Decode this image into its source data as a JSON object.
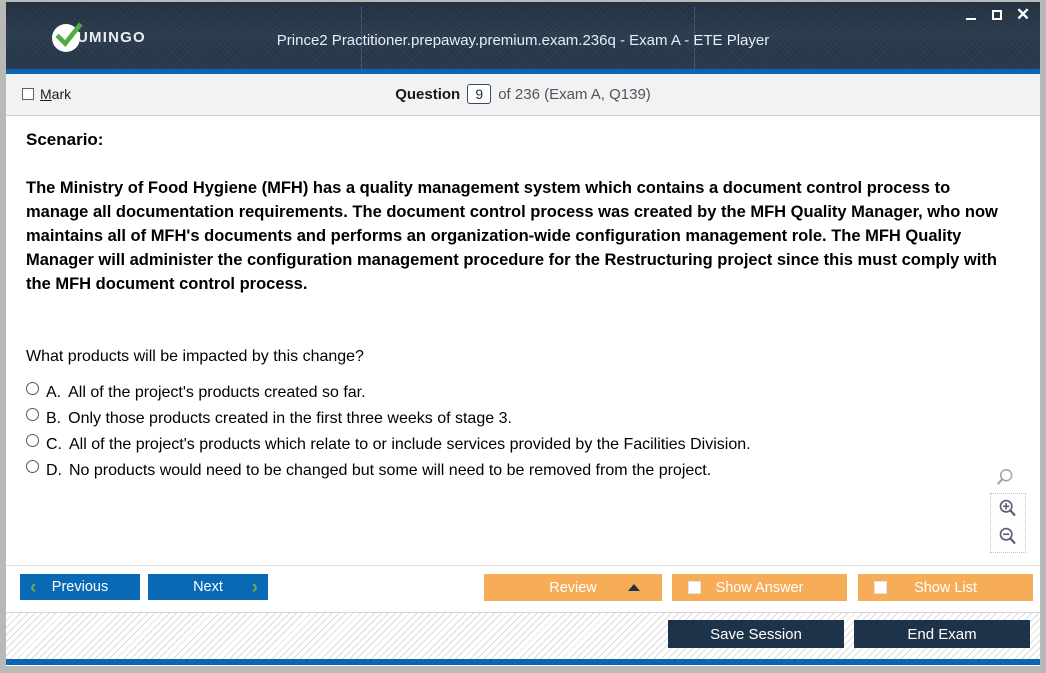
{
  "window": {
    "title": "Prince2 Practitioner.prepaway.premium.exam.236q - Exam A - ETE Player",
    "logo_text": "UMINGO",
    "controls": {
      "minimize": "minimize-icon",
      "maximize": "maximize-icon",
      "close": "✕"
    }
  },
  "question_header": {
    "mark_label_accel": "M",
    "mark_label_rest": "ark",
    "question_word": "Question",
    "question_number": "9",
    "question_rest": "of 236 (Exam A, Q139)"
  },
  "content": {
    "scenario_heading": "Scenario:",
    "scenario_text": "The Ministry of Food Hygiene (MFH) has a quality management system which contains a document control process to manage all documentation requirements. The document control process was created by the MFH Quality Manager, who now maintains all of MFH's documents and performs an organization-wide configuration management role. The MFH Quality Manager will administer the configuration management procedure for the Restructuring project since this must comply with the MFH document control process.",
    "question_text": "What products will be impacted by this change?",
    "options": [
      {
        "letter": "A.",
        "text": "All of the project's products created so far.",
        "selected": false
      },
      {
        "letter": "B.",
        "text": "Only those products created in the first three weeks of stage 3.",
        "selected": false
      },
      {
        "letter": "C.",
        "text": "All of the project's products which relate to or include services provided by the Facilities Division.",
        "selected": false
      },
      {
        "letter": "D.",
        "text": "No products would need to be changed but some will need to be removed from the project.",
        "selected": false
      }
    ]
  },
  "zoom_tools": {
    "reset_icon": "magnifier-icon",
    "zoom_in_icon": "zoom-in-icon",
    "zoom_out_icon": "zoom-out-icon"
  },
  "actions": {
    "previous": "Previous",
    "next": "Next",
    "review": "Review",
    "show_answer": "Show Answer",
    "show_list": "Show List"
  },
  "status": {
    "save_session": "Save Session",
    "end_exam": "End Exam"
  },
  "colors": {
    "titlebar": "#2b3c4e",
    "accent_blue": "#0b65b2",
    "button_blue": "#0a69b4",
    "chevron_green": "#6ab23f",
    "orange": "#f7ad57",
    "navy": "#1d3349"
  }
}
